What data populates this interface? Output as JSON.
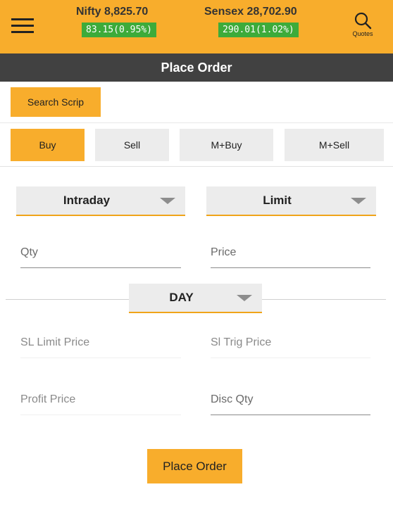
{
  "header": {
    "menu_icon": "hamburger-menu-icon",
    "nifty": {
      "title": "Nifty 8,825.70",
      "change": "83.15(0.95%)"
    },
    "sensex": {
      "title": "Sensex 28,702.90",
      "change": "290.01(1.02%)"
    },
    "quotes": {
      "icon": "search-icon",
      "label": "Quotes"
    },
    "colors": {
      "bar": "#f8ad2c",
      "change_bg": "#3dab3a"
    }
  },
  "titlebar": {
    "title": "Place Order",
    "bg": "#414141"
  },
  "search_scrip_label": "Search Scrip",
  "tabs": [
    {
      "label": "Buy",
      "active": true
    },
    {
      "label": "Sell",
      "active": false
    },
    {
      "label": "M+Buy",
      "active": false
    },
    {
      "label": "M+Sell",
      "active": false
    }
  ],
  "dropdowns": {
    "product": "Intraday",
    "order_type": "Limit",
    "validity": "DAY",
    "caret_icon": "caret-down-icon"
  },
  "fields": {
    "qty": {
      "placeholder": "Qty",
      "value": ""
    },
    "price": {
      "placeholder": "Price",
      "value": ""
    },
    "sl_limit_price": {
      "placeholder": "SL Limit Price",
      "value": ""
    },
    "sl_trig_price": {
      "placeholder": "Sl Trig Price",
      "value": ""
    },
    "profit_price": {
      "placeholder": "Profit Price",
      "value": ""
    },
    "disc_qty": {
      "placeholder": "Disc Qty",
      "value": ""
    }
  },
  "place_order_label": "Place Order"
}
